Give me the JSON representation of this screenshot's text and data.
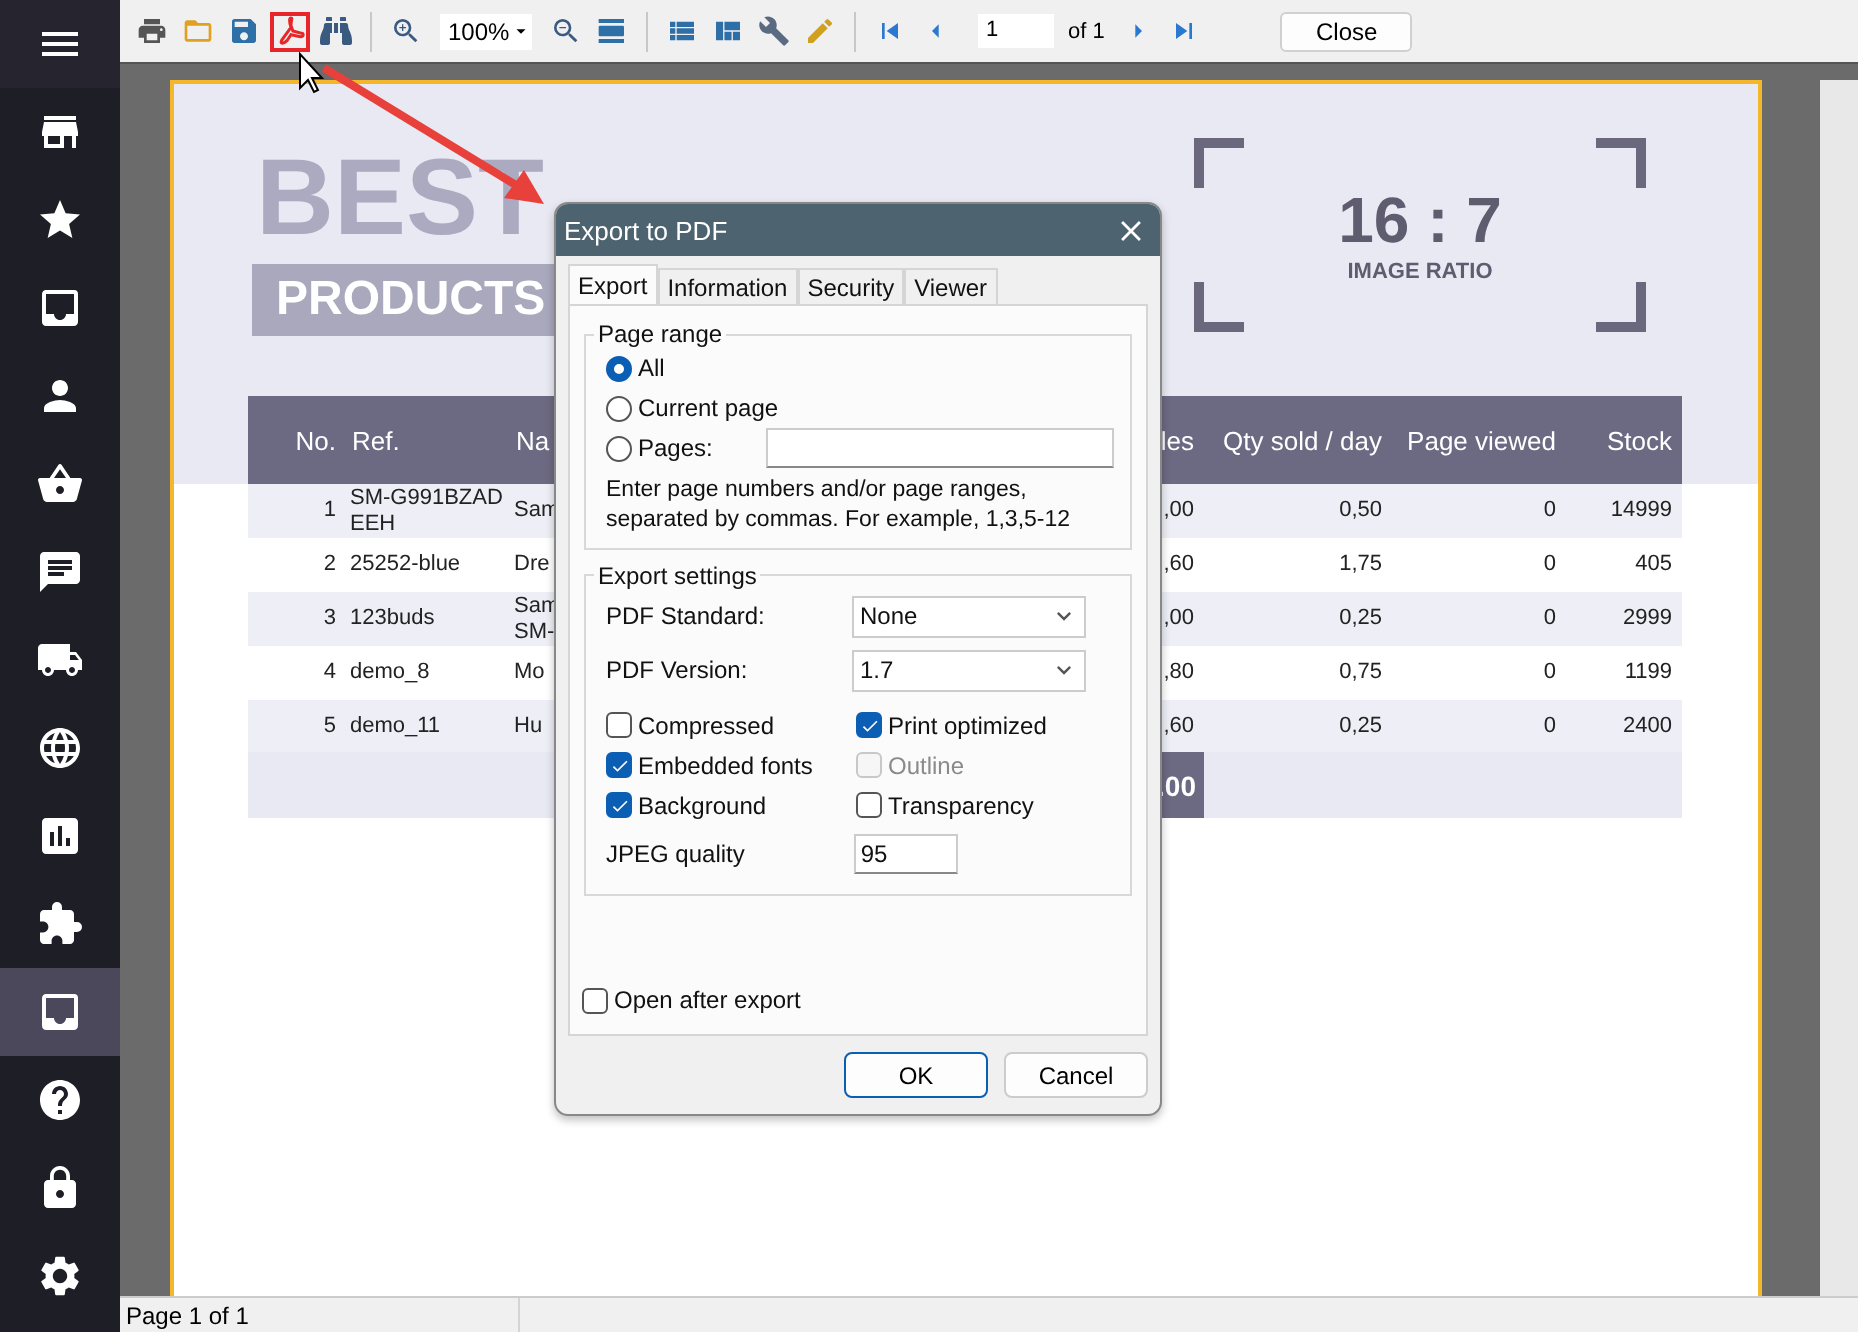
{
  "sidebar": {
    "items": [
      {
        "kind": "menu",
        "selected": false
      },
      {
        "kind": "store",
        "selected": false
      },
      {
        "kind": "star",
        "selected": false
      },
      {
        "kind": "inbox",
        "selected": false
      },
      {
        "kind": "person",
        "selected": false
      },
      {
        "kind": "basket",
        "selected": false
      },
      {
        "kind": "chat",
        "selected": false
      },
      {
        "kind": "truck",
        "selected": false
      },
      {
        "kind": "globe",
        "selected": false
      },
      {
        "kind": "chart",
        "selected": false
      },
      {
        "kind": "puzzle",
        "selected": false
      },
      {
        "kind": "inbox",
        "selected": true
      },
      {
        "kind": "help",
        "selected": false
      },
      {
        "kind": "lock",
        "selected": false
      },
      {
        "kind": "settings",
        "selected": false
      }
    ]
  },
  "toolbar": {
    "groups": [
      [
        {
          "kind": "print",
          "selected": false
        },
        {
          "kind": "open",
          "selected": false
        },
        {
          "kind": "save",
          "selected": false
        },
        {
          "kind": "pdf",
          "selected": true
        },
        {
          "kind": "find",
          "selected": false
        }
      ],
      [
        {
          "kind": "zoom_in",
          "selected": false
        },
        {
          "kind": "zoom",
          "value": "100%"
        },
        {
          "kind": "zoom_out",
          "selected": false
        },
        {
          "kind": "fit",
          "selected": false
        }
      ],
      [
        {
          "kind": "outline",
          "selected": false
        },
        {
          "kind": "layout",
          "selected": false
        },
        {
          "kind": "tools",
          "selected": false
        },
        {
          "kind": "edit",
          "selected": false
        }
      ],
      [
        {
          "kind": "first",
          "selected": false
        },
        {
          "kind": "prev",
          "selected": false
        },
        {
          "kind": "page",
          "value": "1",
          "of": "of 1"
        },
        {
          "kind": "next",
          "selected": false
        },
        {
          "kind": "last",
          "selected": false
        }
      ]
    ],
    "close": "Close"
  },
  "report": {
    "title": "BEST",
    "subtitle": "PRODUCTS",
    "ratio": "16 : 7",
    "ratio_caption": "IMAGE RATIO",
    "columns": [
      "No.",
      "Ref.",
      "Na",
      "les",
      "Qty sold / day",
      "Page viewed",
      "Stock"
    ],
    "rows": [
      [
        "1",
        "SM-G991BZAD EEH",
        "Sam",
        ",00",
        "0,50",
        "0",
        "14999"
      ],
      [
        "2",
        "25252-blue",
        "Dre",
        ",60",
        "1,75",
        "0",
        "405"
      ],
      [
        "3",
        "123buds",
        "Sam SM-",
        ",00",
        "0,25",
        "0",
        "2999"
      ],
      [
        "4",
        "demo_8",
        "Mo",
        ",80",
        "0,75",
        "0",
        "1199"
      ],
      [
        "5",
        "demo_11",
        "Hu",
        ",60",
        "0,25",
        "0",
        "2400"
      ]
    ],
    "total": ".00"
  },
  "dialog": {
    "title": "Export to PDF",
    "tabs": [
      {
        "label": "Export",
        "selected": true
      },
      {
        "label": "Information",
        "selected": false
      },
      {
        "label": "Security",
        "selected": false
      },
      {
        "label": "Viewer",
        "selected": false
      }
    ],
    "page_range": {
      "title": "Page range",
      "options": [
        {
          "label": "All",
          "selected": true
        },
        {
          "label": "Current page",
          "selected": false
        },
        {
          "label": "Pages:",
          "selected": false
        }
      ],
      "hint": "Enter page numbers and/or page ranges, separated by commas. For example, 1,3,5-12"
    },
    "export_settings": {
      "title": "Export settings",
      "selects": [
        {
          "label": "PDF Standard:",
          "value": "None"
        },
        {
          "label": "PDF Version:",
          "value": "1.7"
        }
      ],
      "checkboxes": [
        {
          "label": "Compressed",
          "checked": false,
          "disabled": false
        },
        {
          "label": "Print optimized",
          "checked": true,
          "disabled": false
        },
        {
          "label": "Embedded fonts",
          "checked": true,
          "disabled": false
        },
        {
          "label": "Outline",
          "checked": false,
          "disabled": true
        },
        {
          "label": "Background",
          "checked": true,
          "disabled": false
        },
        {
          "label": "Transparency",
          "checked": false,
          "disabled": false
        }
      ],
      "jpeg_label": "JPEG quality",
      "jpeg_value": "95"
    },
    "open_after_export": {
      "label": "Open after export",
      "checked": false
    },
    "buttons": [
      {
        "label": "OK",
        "default": true
      },
      {
        "label": "Cancel",
        "default": false
      }
    ]
  },
  "status_bar": {
    "text": "Page 1 of 1"
  }
}
